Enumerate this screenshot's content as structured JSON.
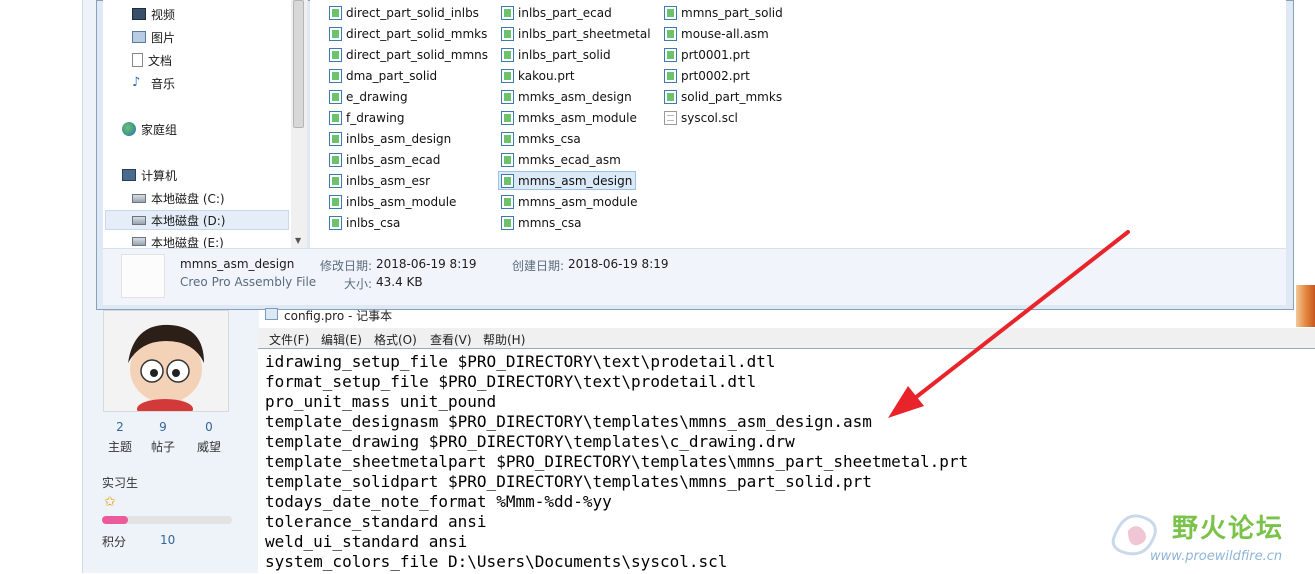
{
  "explorer": {
    "nav_items": [
      {
        "label": "视频",
        "icon": "video-icon"
      },
      {
        "label": "图片",
        "icon": "picture-icon"
      },
      {
        "label": "文档",
        "icon": "document-icon"
      },
      {
        "label": "音乐",
        "icon": "music-icon"
      },
      {
        "label": "家庭组",
        "icon": "homegroup-icon"
      },
      {
        "label": "计算机",
        "icon": "computer-icon"
      },
      {
        "label": "本地磁盘 (C:)",
        "icon": "drive-c-icon"
      },
      {
        "label": "本地磁盘 (D:)",
        "icon": "drive-d-icon"
      },
      {
        "label": "本地磁盘 (E:)",
        "icon": "drive-e-icon"
      }
    ],
    "files_col1": [
      "direct_part_solid_inlbs",
      "direct_part_solid_mmks",
      "direct_part_solid_mmns",
      "dma_part_solid",
      "e_drawing",
      "f_drawing",
      "inlbs_asm_design",
      "inlbs_asm_ecad",
      "inlbs_asm_esr",
      "inlbs_asm_module",
      "inlbs_csa"
    ],
    "files_col2": [
      "inlbs_part_ecad",
      "inlbs_part_sheetmetal",
      "inlbs_part_solid",
      "kakou.prt",
      "mmks_asm_design",
      "mmks_asm_module",
      "mmks_csa",
      "mmks_ecad_asm",
      "mmns_asm_design",
      "mmns_asm_module",
      "mmns_csa"
    ],
    "files_col3": [
      "mmns_part_solid",
      "mouse-all.asm",
      "prt0001.prt",
      "prt0002.prt",
      "solid_part_mmks",
      "syscol.scl"
    ],
    "selected_file": "mmns_asm_design",
    "details": {
      "name": "mmns_asm_design",
      "type": "Creo Pro Assembly File",
      "modified_label": "修改日期:",
      "modified": "2018-06-19 8:19",
      "created_label": "创建日期:",
      "created": "2018-06-19 8:19",
      "size_label": "大小:",
      "size": "43.4 KB"
    }
  },
  "forum": {
    "stats": [
      {
        "value": "2",
        "label": "主题"
      },
      {
        "value": "9",
        "label": "帖子"
      },
      {
        "value": "0",
        "label": "威望"
      }
    ],
    "level": "实习生",
    "progress": 0.2,
    "credits_label": "积分",
    "credits_value": "10"
  },
  "notepad": {
    "title": "config.pro - 记事本",
    "menus": [
      "文件(F)",
      "编辑(E)",
      "格式(O)",
      "查看(V)",
      "帮助(H)"
    ],
    "lines": [
      "idrawing_setup_file $PRO_DIRECTORY\\text\\prodetail.dtl",
      "format_setup_file $PRO_DIRECTORY\\text\\prodetail.dtl",
      "pro_unit_mass unit_pound",
      "template_designasm $PRO_DIRECTORY\\templates\\mmns_asm_design.asm",
      "template_drawing $PRO_DIRECTORY\\templates\\c_drawing.drw",
      "template_sheetmetalpart $PRO_DIRECTORY\\templates\\mmns_part_sheetmetal.prt",
      "template_solidpart $PRO_DIRECTORY\\templates\\mmns_part_solid.prt",
      "todays_date_note_format %Mmm-%dd-%yy",
      "tolerance_standard ansi",
      "weld_ui_standard ansi",
      "system_colors_file D:\\Users\\Documents\\syscol.scl"
    ]
  },
  "watermark": {
    "text": "野火论坛",
    "url": "www.proewildfire.cn"
  },
  "colors": {
    "arrow": "#e8242a",
    "selection": "#dceaf8",
    "watermark_green": "#7ac34a"
  }
}
